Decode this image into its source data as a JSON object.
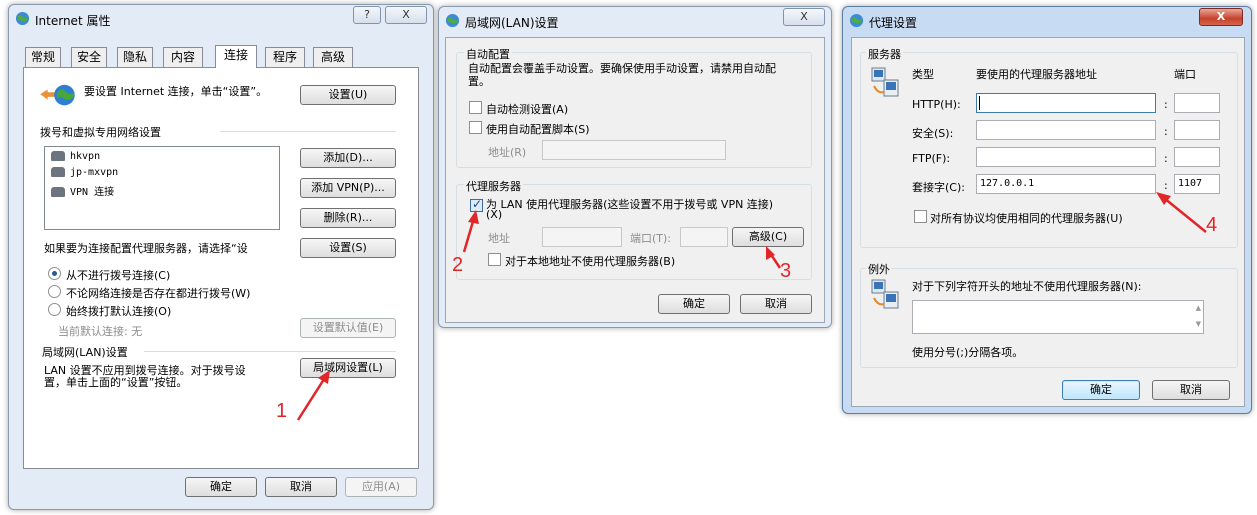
{
  "internet_props": {
    "title": "Internet 属性",
    "help_btn": "?",
    "close_btn": "X",
    "tabs": [
      "常规",
      "安全",
      "隐私",
      "内容",
      "连接",
      "程序",
      "高级"
    ],
    "selected_tab": "连接",
    "setup_text": "要设置 Internet 连接，单击“设置”。",
    "setup_btn": "设置(U)",
    "dialup_header": "拨号和虚拟专用网络设置",
    "connections": [
      "hkvpn",
      "jp-mxvpn",
      "VPN 连接"
    ],
    "add_btn": "添加(D)...",
    "add_vpn_btn": "添加 VPN(P)...",
    "remove_btn": "删除(R)...",
    "proxy_hint": "如果要为连接配置代理服务器，请选择“设",
    "settings_btn": "设置(S)",
    "radio_never": "从不进行拨号连接(C)",
    "radio_when_no_net": "不论网络连接是否存在都进行拨号(W)",
    "radio_always": "始终拨打默认连接(O)",
    "current_default": "当前默认连接: 无",
    "set_default_btn": "设置默认值(E)",
    "lan_header": "局域网(LAN)设置",
    "lan_text_1": "LAN 设置不应用到拨号连接。对于拨号设",
    "lan_text_2": "置，单击上面的“设置”按钮。",
    "lan_btn": "局域网设置(L)",
    "ok": "确定",
    "cancel": "取消",
    "apply": "应用(A)"
  },
  "lan_settings": {
    "title": "局域网(LAN)设置",
    "close_btn": "X",
    "auto_header": "自动配置",
    "auto_text_1": "自动配置会覆盖手动设置。要确保使用手动设置，请禁用自动配",
    "auto_text_2": "置。",
    "auto_detect": "自动检测设置(A)",
    "auto_script": "使用自动配置脚本(S)",
    "address_label": "地址(R)",
    "proxy_header": "代理服务器",
    "use_proxy_1": "为 LAN 使用代理服务器(这些设置不用于拨号或 VPN 连接)",
    "use_proxy_2": "(X)",
    "use_proxy_checked": true,
    "addr_label": "地址",
    "port_label": "端口(T):",
    "advanced_btn": "高级(C)",
    "bypass_local": "对于本地地址不使用代理服务器(B)",
    "ok": "确定",
    "cancel": "取消"
  },
  "proxy_settings": {
    "title": "代理设置",
    "close_btn": "X",
    "servers_header": "服务器",
    "col_type": "类型",
    "col_address": "要使用的代理服务器地址",
    "col_port": "端口",
    "rows": [
      {
        "label": "HTTP(H):",
        "address": "",
        "port": ""
      },
      {
        "label": "安全(S):",
        "address": "",
        "port": ""
      },
      {
        "label": "FTP(F):",
        "address": "",
        "port": ""
      },
      {
        "label": "套接字(C):",
        "address": "127.0.0.1",
        "port": "1107"
      }
    ],
    "colon": ":",
    "same_proxy": "对所有协议均使用相同的代理服务器(U)",
    "exceptions_header": "例外",
    "exceptions_text": "对于下列字符开头的地址不使用代理服务器(N):",
    "exceptions_value": "",
    "separator_hint": "使用分号(;)分隔各项。",
    "ok": "确定",
    "cancel": "取消"
  },
  "annotations": [
    "1",
    "2",
    "3",
    "4"
  ],
  "colors": {
    "annotation": "#e1262a",
    "active_title": "#c7dcf3",
    "inactive_title": "#e3ecf6"
  }
}
